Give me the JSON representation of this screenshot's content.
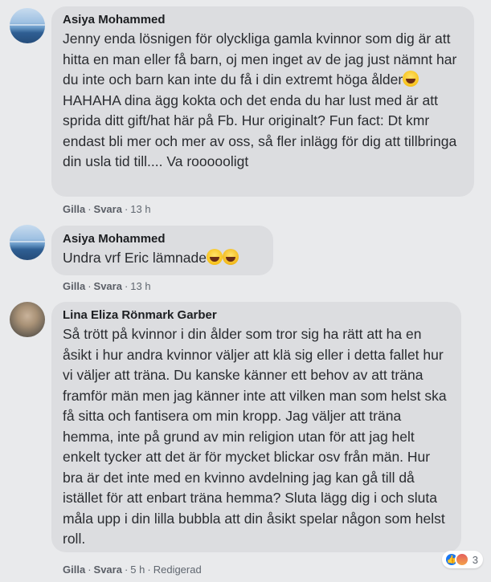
{
  "comments": [
    {
      "author": "Asiya Mohammed",
      "text_before": "Jenny enda lösnigen för olyckliga gamla kvinnor som dig är att hitta en man eller få barn, oj men inget av de jag just nämnt har du inte och barn kan inte du få i din extremt höga ålder",
      "text_after": " HAHAHA dina ägg kokta och det enda du har lust med är att sprida ditt gift/hat här på Fb. Hur originalt? Fun fact: Dt kmr endast bli mer och mer av oss, så fler inlägg för dig att tillbringa din usla tid till.... Va roooooligt",
      "like_label": "Gilla",
      "reply_label": "Svara",
      "time": "13 h"
    },
    {
      "author": "Asiya Mohammed",
      "text_before": "Undra vrf Eric lämnade",
      "text_after": "",
      "like_label": "Gilla",
      "reply_label": "Svara",
      "time": "13 h"
    },
    {
      "author": "Lina Eliza Rönmark Garber",
      "text_before": "Så trött på kvinnor i din ålder som tror sig ha rätt att ha en åsikt i hur andra kvinnor väljer att klä sig eller i detta fallet hur vi väljer att träna. Du kanske känner ett behov av att träna framför män men jag känner inte att vilken man som helst ska få sitta och fantisera om min kropp. Jag väljer att träna hemma, inte på grund av min religion utan för att jag helt enkelt tycker att det är för mycket blickar osv från män. Hur bra är det inte med en kvinno avdelning jag kan gå till då istället för att enbart träna hemma? Sluta lägg dig i och sluta måla upp i din lilla bubbla att din åsikt spelar någon som helst roll.",
      "text_after": "",
      "like_label": "Gilla",
      "reply_label": "Svara",
      "time": "5 h",
      "edited_label": "Redigerad",
      "reaction_count": "3"
    }
  ],
  "icons": [
    "laughing-emoji-icon",
    "thinking-emoji-icon",
    "like-reaction-icon",
    "angry-reaction-icon"
  ],
  "colors": {
    "bubble": "#dcdde0",
    "background": "#e9eaec",
    "like": "#1877f2"
  }
}
